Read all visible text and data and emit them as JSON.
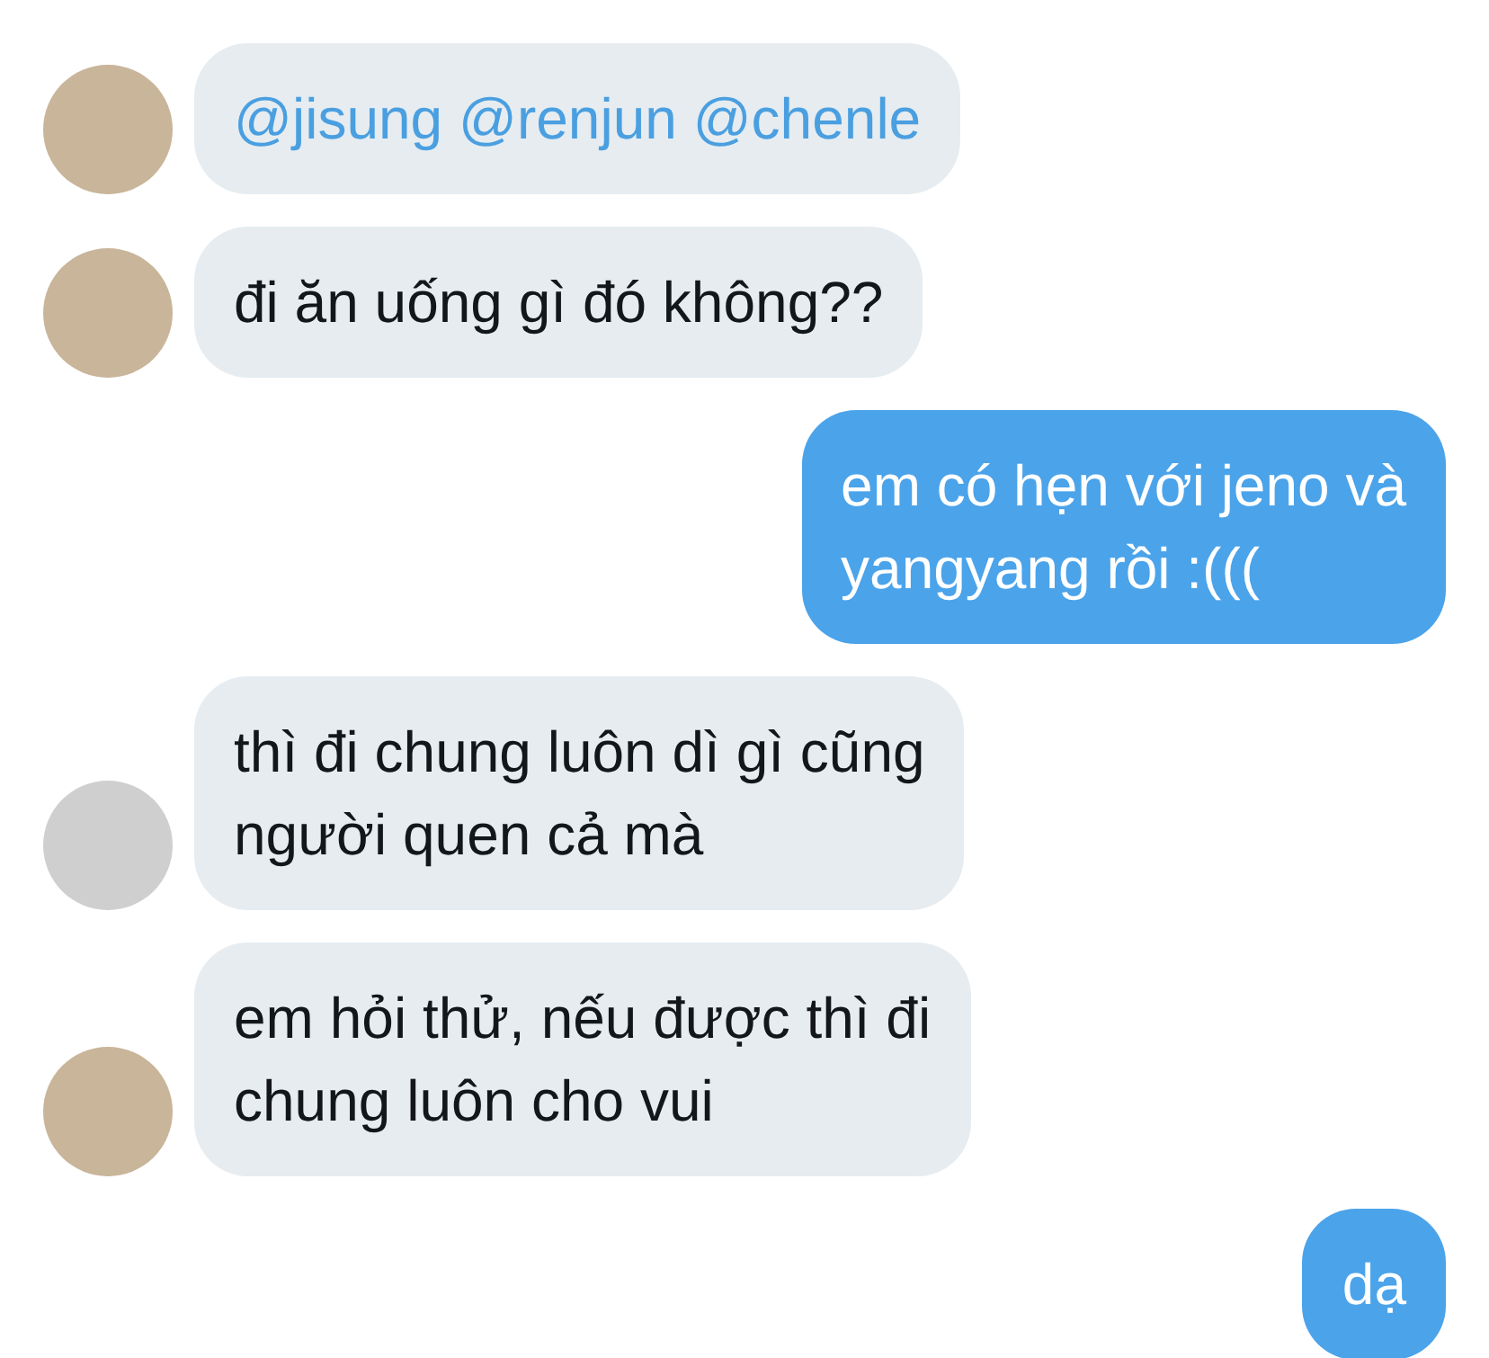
{
  "messages": [
    {
      "outgoing": false,
      "color": "#c9b59a",
      "kind": "mention",
      "lines": [
        "@jisung @renjun @chenle"
      ]
    },
    {
      "outgoing": false,
      "color": "#c9b59a",
      "kind": "text",
      "lines": [
        "đi ăn uống gì đó không??"
      ]
    },
    {
      "outgoing": true,
      "kind": "text",
      "lines": [
        "em có hẹn với jeno và",
        "yangyang rồi :((("
      ]
    },
    {
      "outgoing": false,
      "color": "#cfcfcf",
      "kind": "text",
      "lines": [
        "thì đi chung luôn dì gì cũng",
        "người quen cả mà"
      ]
    },
    {
      "outgoing": false,
      "color": "#c9b59a",
      "kind": "text",
      "lines": [
        "em hỏi thử, nếu được thì đi",
        "chung luôn cho vui"
      ]
    },
    {
      "outgoing": true,
      "kind": "text",
      "lines": [
        "dạ"
      ]
    }
  ]
}
